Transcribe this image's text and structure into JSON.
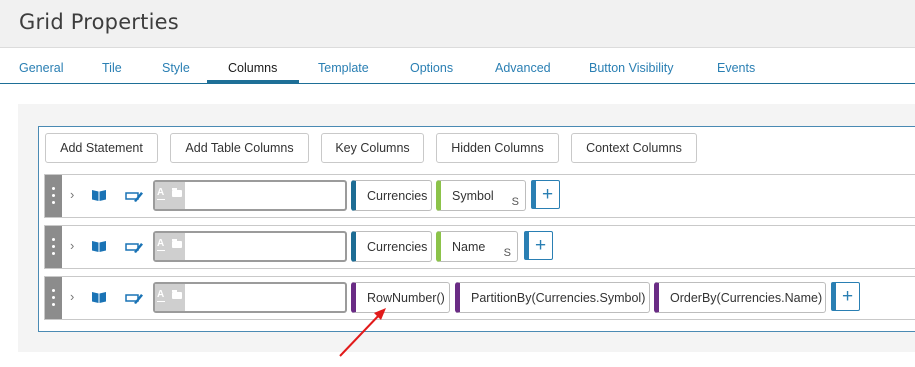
{
  "window": {
    "title": "Grid Properties"
  },
  "tabs": [
    "General",
    "Tile",
    "Style",
    "Columns",
    "Template",
    "Options",
    "Advanced",
    "Button Visibility",
    "Events"
  ],
  "active_tab": "Columns",
  "toolbar": [
    "Add Statement",
    "Add Table Columns",
    "Key Columns",
    "Hidden Columns",
    "Context Columns"
  ],
  "rows": [
    {
      "name_value": "",
      "source": "Currencies",
      "field": "Symbol",
      "field_badge": "S"
    },
    {
      "name_value": "",
      "source": "Currencies",
      "field": "Name",
      "field_badge": "S"
    },
    {
      "name_value": "",
      "functions": [
        "RowNumber()",
        "PartitionBy(Currencies.Symbol)",
        "OrderBy(Currencies.Name)"
      ]
    }
  ],
  "icons": {
    "drag": "drag-handle-icon",
    "expand": "chevron-right-icon",
    "book": "book-icon",
    "edit": "edit-icon",
    "text_type": "text-type-icon",
    "folder": "folder-icon",
    "add": "plus-icon",
    "annotation": "red-arrow-icon"
  },
  "colors": {
    "tab_accent": "#1e6f97",
    "link": "#2a7fb3",
    "table_pill": "#1d6c94",
    "field_pill": "#8cc34a",
    "function_pill": "#6a2c85",
    "annotation_arrow": "#e11a1a"
  }
}
